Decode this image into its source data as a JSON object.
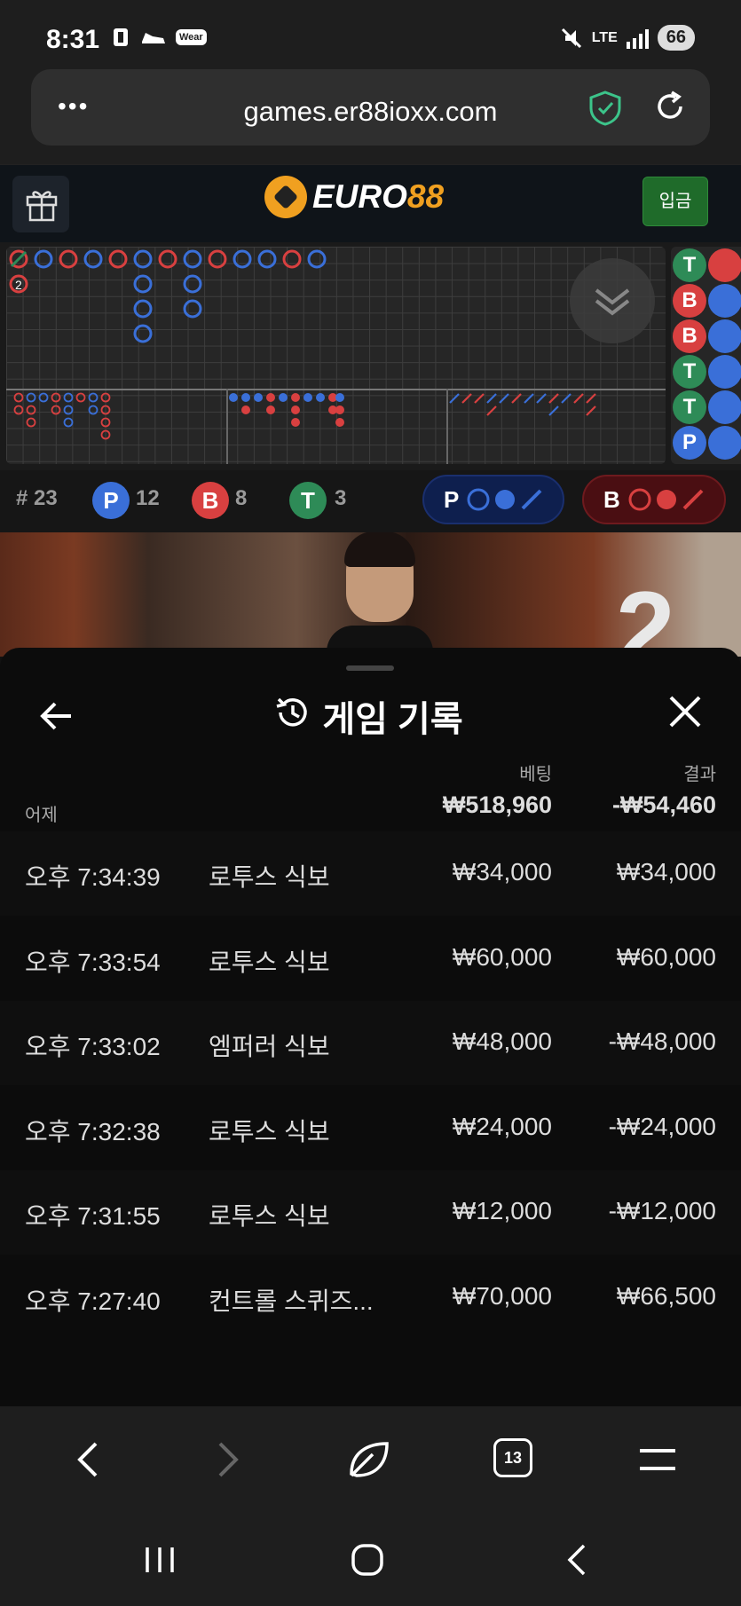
{
  "status": {
    "time": "8:31",
    "left_icons": [
      "b-icon",
      "shoe-icon",
      "wear-icon"
    ],
    "wear_label": "Wear",
    "network": "LTE",
    "battery": "66"
  },
  "browser": {
    "url": "games.er88ioxx.com"
  },
  "site": {
    "logo_part1": "EURO",
    "logo_part2": "88",
    "deposit_label": "입금"
  },
  "roadmap": {
    "side": [
      "T",
      "B",
      "B",
      "T",
      "T",
      "P"
    ],
    "second_col_label": "2"
  },
  "stats": {
    "count_label": "# 23",
    "player_letter": "P",
    "player_count": "12",
    "banker_letter": "B",
    "banker_count": "8",
    "tie_letter": "T",
    "tie_count": "3",
    "p_pill": "P",
    "b_pill": "B"
  },
  "video": {
    "overlay_number": "2"
  },
  "panel": {
    "title": "게임 기록",
    "col_bet": "베팅",
    "col_result": "결과",
    "group_label": "어제",
    "total_bet": "₩518,960",
    "total_result": "-₩54,460",
    "rows": [
      {
        "time": "오후 7:34:39",
        "game": "로투스 식보",
        "bet": "₩34,000",
        "result": "₩34,000"
      },
      {
        "time": "오후 7:33:54",
        "game": "로투스 식보",
        "bet": "₩60,000",
        "result": "₩60,000"
      },
      {
        "time": "오후 7:33:02",
        "game": "엠퍼러 식보",
        "bet": "₩48,000",
        "result": "-₩48,000"
      },
      {
        "time": "오후 7:32:38",
        "game": "로투스 식보",
        "bet": "₩24,000",
        "result": "-₩24,000"
      },
      {
        "time": "오후 7:31:55",
        "game": "로투스 식보",
        "bet": "₩12,000",
        "result": "-₩12,000"
      },
      {
        "time": "오후 7:27:40",
        "game": "컨트롤 스퀴즈...",
        "bet": "₩70,000",
        "result": "₩66,500"
      }
    ]
  },
  "nav": {
    "tab_count": "13"
  },
  "colors": {
    "player_blue": "#3a6fd8",
    "banker_red": "#d84040",
    "tie_green": "#2e8b57",
    "deposit_green": "#1f6b2a",
    "logo_gold": "#f0a020"
  }
}
